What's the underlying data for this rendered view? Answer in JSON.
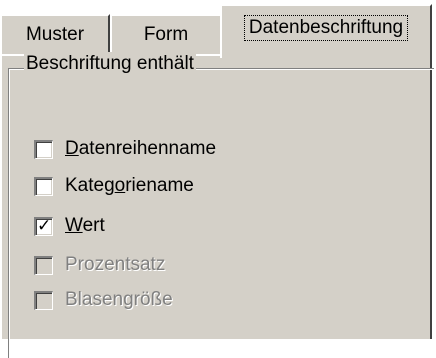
{
  "tabs": [
    {
      "label": "Muster",
      "active": false
    },
    {
      "label": "Form",
      "active": false
    },
    {
      "label": "Datenbeschriftung",
      "active": true
    }
  ],
  "group": {
    "label": "Beschriftung enthält"
  },
  "options": [
    {
      "pre": "",
      "mnemonic": "D",
      "post": "atenreihenname",
      "checked": false,
      "enabled": true
    },
    {
      "pre": "Kateg",
      "mnemonic": "o",
      "post": "riename",
      "checked": false,
      "enabled": true
    },
    {
      "pre": "",
      "mnemonic": "W",
      "post": "ert",
      "checked": true,
      "enabled": true
    },
    {
      "pre": "",
      "mnemonic": "",
      "post": "Prozentsatz",
      "checked": false,
      "enabled": false
    },
    {
      "pre": "",
      "mnemonic": "",
      "post": "Blasengröße",
      "checked": false,
      "enabled": false
    }
  ],
  "colors": {
    "face": "#d4d0c8",
    "shadow": "#808080",
    "disabled_text": "#808080"
  }
}
